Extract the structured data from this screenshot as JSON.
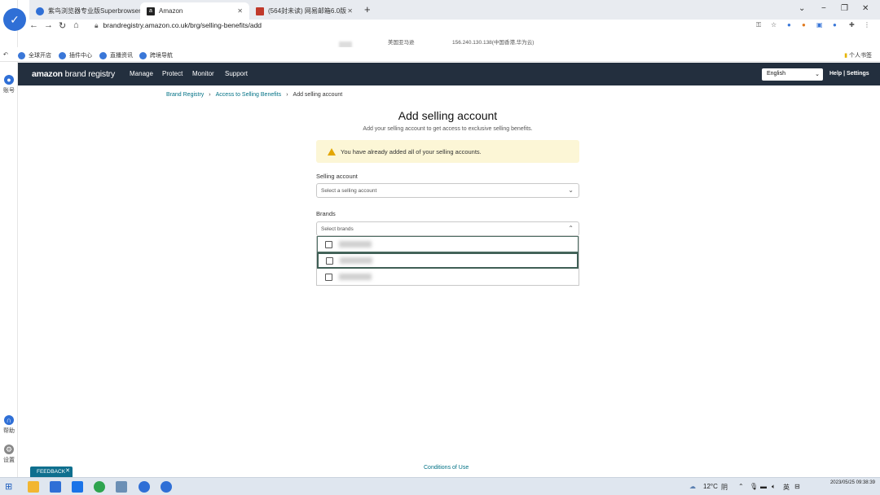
{
  "browser": {
    "tabs": [
      {
        "label": "紫鸟浏览器专业版Superbrowser",
        "active": false
      },
      {
        "label": "Amazon",
        "active": true
      },
      {
        "label": "(564封未读) 网易邮箱6.0版",
        "active": false
      }
    ],
    "new_tab": "+",
    "window_controls": {
      "dropdown": "⌄",
      "minimize": "−",
      "restore": "❐",
      "close": "✕"
    },
    "url": "brandregistry.amazon.co.uk/brg/selling-benefits/add",
    "info": {
      "country": "美国亚马逊",
      "ip": "156.240.130.138(中国香港,华为云)"
    },
    "bookmarks": [
      "全球开店",
      "插件中心",
      "直播资讯",
      "跨境导航"
    ],
    "bookmarks_right": "个人书签"
  },
  "rail": {
    "account_label": "账号",
    "help_label": "帮助",
    "settings_label": "设置"
  },
  "header": {
    "brand_amazon": "amazon",
    "brand_rest": " brand registry",
    "nav": [
      "Manage",
      "Protect",
      "Monitor",
      "Support"
    ],
    "language": "English",
    "help": "Help",
    "settings": "Settings"
  },
  "breadcrumb": {
    "items": [
      "Brand Registry",
      "Access to Selling Benefits"
    ],
    "current": "Add selling account"
  },
  "page": {
    "title": "Add selling account",
    "subtitle": "Add your selling account to get access to exclusive selling benefits.",
    "alert": "You have already added all of your selling accounts.",
    "selling_account_label": "Selling account",
    "selling_account_placeholder": "Select a selling account",
    "brands_label": "Brands",
    "brands_placeholder": "Select brands",
    "brand_options_count": 3
  },
  "footer": {
    "conditions": "Conditions of Use",
    "feedback": "FEEDBACK"
  },
  "taskbar": {
    "weather": "12°C",
    "weather_text": "阴",
    "ime": "英",
    "date": "2023/05/25 09:38:39"
  },
  "colors": {
    "amazon_header": "#232f3e",
    "link": "#007185",
    "alert_bg": "#fcf6d6",
    "feedback_bg": "#0f6f8e"
  }
}
